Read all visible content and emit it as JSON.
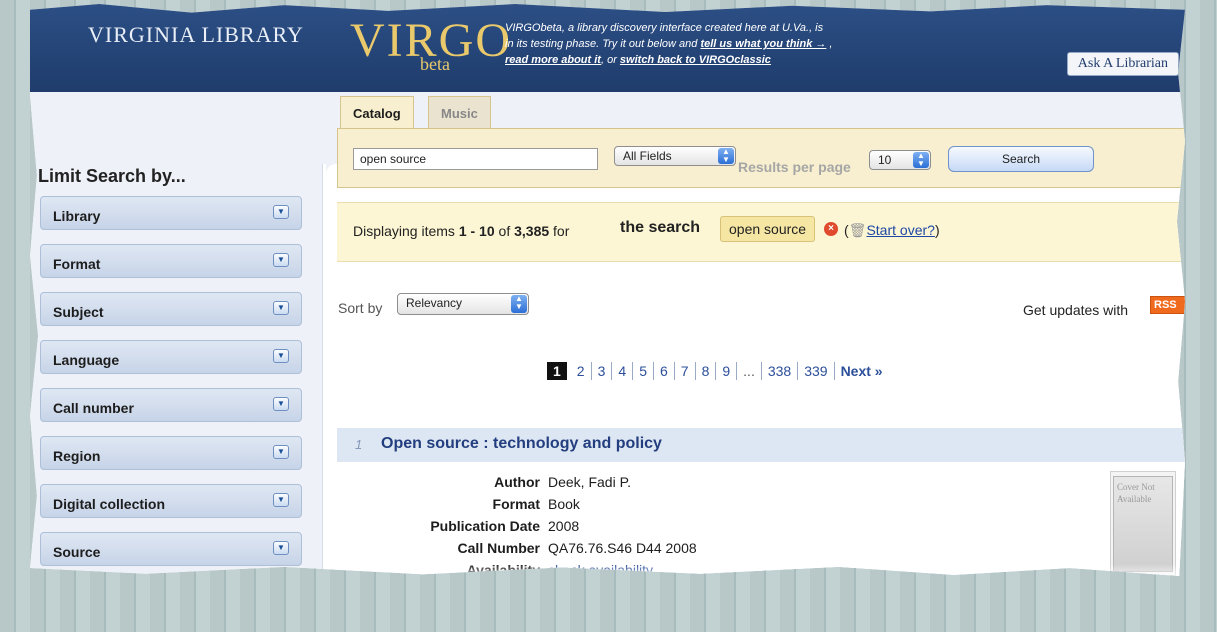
{
  "header": {
    "uva_logo": "VIRGINIA LIBRARY",
    "virgo_logo": "VIRGO",
    "virgo_beta": "beta",
    "note_line1": "VIRGObeta, a library discovery interface created here at U.Va., is",
    "note_line2_prefix": "in its testing phase. Try it out below and ",
    "note_feedback_link": "tell us what you think →",
    "note_line2_suffix": " ,",
    "note_read_more_link": "read more about it",
    "note_or": ", or ",
    "note_switch_link": "switch back to VIRGOclassic",
    "ask_librarian": "Ask A Librarian"
  },
  "sidebar": {
    "title": "Limit Search by...",
    "facets": [
      {
        "label": "Library"
      },
      {
        "label": "Format"
      },
      {
        "label": "Subject"
      },
      {
        "label": "Language"
      },
      {
        "label": "Call number"
      },
      {
        "label": "Region"
      },
      {
        "label": "Digital collection"
      },
      {
        "label": "Source"
      }
    ]
  },
  "tabs": [
    {
      "label": "Catalog",
      "active": true
    },
    {
      "label": "Music",
      "active": false
    }
  ],
  "search": {
    "query": "open source",
    "field_select": "All Fields",
    "results_per_page_label": "Results per page",
    "results_per_page": "10",
    "button": "Search"
  },
  "results_banner": {
    "prefix": "Displaying items ",
    "range": "1 - 10",
    "of": " of ",
    "total": "3,385",
    "for": " for ",
    "search_word": "the search",
    "query_chip": "open source",
    "start_over_open": "(",
    "start_over_link": "Start over?",
    "start_over_close": ")"
  },
  "sort": {
    "label": "Sort by",
    "value": "Relevancy"
  },
  "rss": {
    "label": "Get updates with",
    "badge": "RSS"
  },
  "pagination": {
    "current": "1",
    "pages": [
      "2",
      "3",
      "4",
      "5",
      "6",
      "7",
      "8",
      "9"
    ],
    "gap": "...",
    "last_pages": [
      "338",
      "339"
    ],
    "next": "Next »"
  },
  "result": {
    "number": "1",
    "title": "Open source : technology and policy",
    "fields": [
      {
        "label": "Author",
        "value": "Deek, Fadi P."
      },
      {
        "label": "Format",
        "value": "Book"
      },
      {
        "label": "Publication Date",
        "value": "2008"
      },
      {
        "label": "Call Number",
        "value": "QA76.76.S46 D44 2008"
      },
      {
        "label": "Availability",
        "value": "check availability"
      }
    ],
    "cover_text": "Cover Not Available"
  },
  "colors": {
    "header_blue": "#1f3c6c",
    "facet_blue": "#c7d4e8",
    "search_area": "#f7efcf",
    "banner_yellow": "#fcf6d4",
    "link_blue": "#2c4f9a",
    "rss_orange": "#f06a1e"
  }
}
